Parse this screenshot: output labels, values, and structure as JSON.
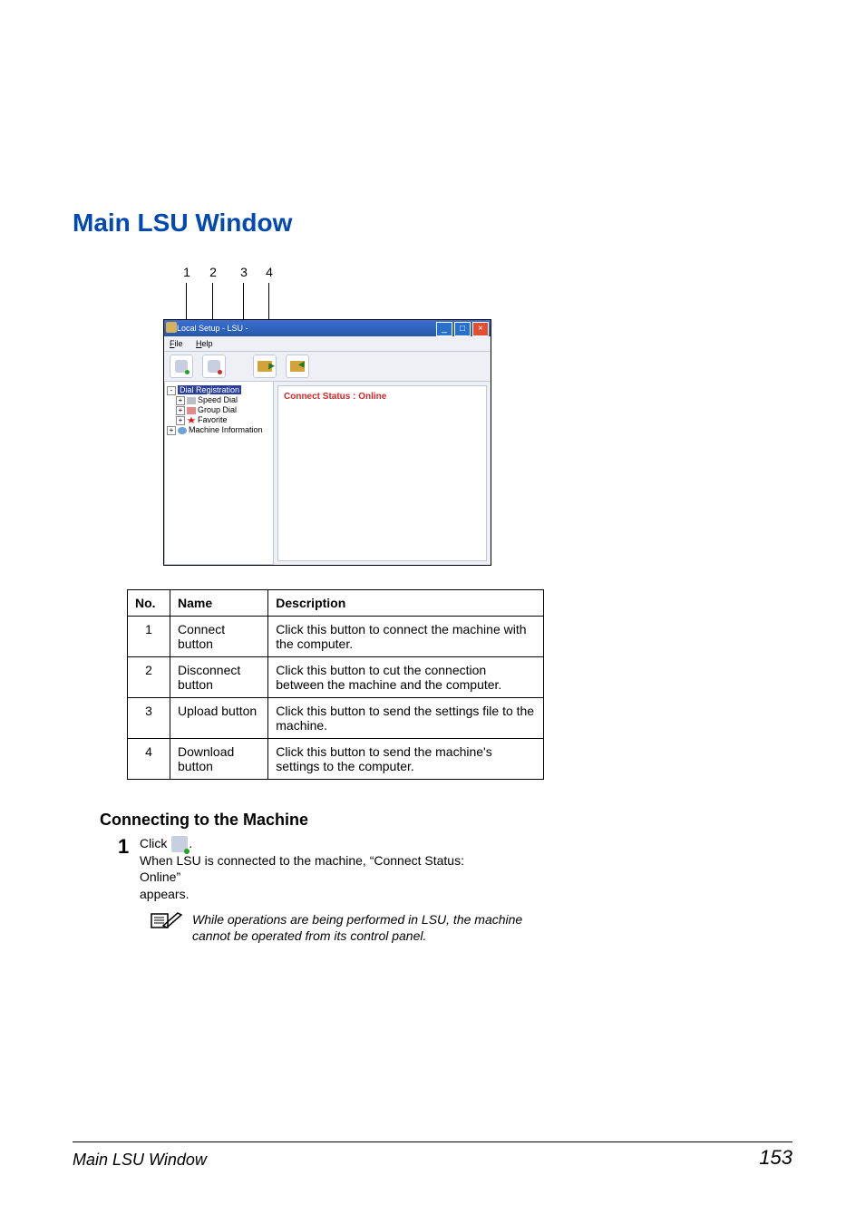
{
  "heading": "Main LSU Window",
  "figure": {
    "indicators": [
      "1",
      "2",
      "3",
      "4"
    ],
    "window_title": "Local Setup - LSU -",
    "menu": {
      "file": "File",
      "help": "Help"
    },
    "tree": {
      "root": "Dial Registration",
      "items": [
        "Speed Dial",
        "Group Dial",
        "Favorite",
        "Machine Information"
      ]
    },
    "content_status": "Connect Status : Online"
  },
  "table": {
    "headers": {
      "no": "No.",
      "name": "Name",
      "desc": "Description"
    },
    "rows": [
      {
        "no": "1",
        "name": "Connect button",
        "desc": "Click this button to connect the machine with the computer."
      },
      {
        "no": "2",
        "name": "Disconnect button",
        "desc": "Click this button to cut the connection between the machine and the computer."
      },
      {
        "no": "3",
        "name": "Upload button",
        "desc": "Click this button to send the settings file to the machine."
      },
      {
        "no": "4",
        "name": "Download button",
        "desc": "Click this button to send the machine's settings to the computer."
      }
    ]
  },
  "subheading": "Connecting to the Machine",
  "step1": {
    "num": "1",
    "pre": "Click ",
    "post": ".",
    "line2a": "When LSU is connected to the machine, “Connect Status: Online”",
    "line2b": "appears."
  },
  "note_text": "While operations are being performed in LSU, the machine cannot be operated from its control panel.",
  "footer": {
    "title": "Main LSU Window",
    "page": "153"
  }
}
